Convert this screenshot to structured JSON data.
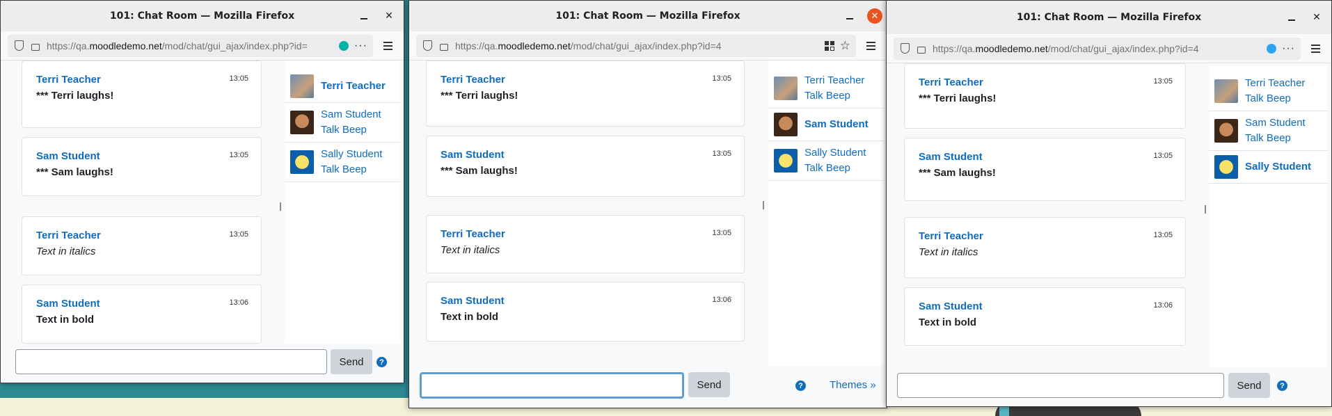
{
  "windows": [
    {
      "title": "101: Chat Room — Mozilla Firefox",
      "url_prefix": "https://qa.",
      "url_domain": "moodledemo.net",
      "url_path": "/mod/chat/gui_ajax/index.php?id=",
      "dot_color": "#00b3a4",
      "messages": [
        {
          "name": "Terri Teacher",
          "time": "13:05",
          "text": "*** Terri laughs!"
        },
        {
          "name": "Sam Student",
          "time": "13:05",
          "text": "*** Sam laughs!"
        },
        {
          "name": "Terri Teacher",
          "time": "13:05",
          "text": "Text in italics"
        },
        {
          "name": "Sam Student",
          "time": "13:06",
          "text": "Text in bold"
        }
      ],
      "users": [
        {
          "name": "Terri Teacher",
          "links": ""
        },
        {
          "name": "Sam Student",
          "links": "Talk Beep"
        },
        {
          "name": "Sally Student",
          "links": "Talk Beep"
        }
      ],
      "send_label": "Send",
      "help_label": "?"
    },
    {
      "title": "101: Chat Room — Mozilla Firefox",
      "url_prefix": "https://qa.",
      "url_domain": "moodledemo.net",
      "url_path": "/mod/chat/gui_ajax/index.php?id=4",
      "messages": [
        {
          "name": "Terri Teacher",
          "time": "13:05",
          "text": "*** Terri laughs!"
        },
        {
          "name": "Sam Student",
          "time": "13:05",
          "text": "*** Sam laughs!"
        },
        {
          "name": "Terri Teacher",
          "time": "13:05",
          "text": "Text in italics"
        },
        {
          "name": "Sam Student",
          "time": "13:06",
          "text": "Text in bold"
        }
      ],
      "users": [
        {
          "name": "Terri Teacher",
          "links": "Talk Beep"
        },
        {
          "name": "Sam Student",
          "links": ""
        },
        {
          "name": "Sally Student",
          "links": "Talk Beep"
        }
      ],
      "send_label": "Send",
      "help_label": "?",
      "themes_label": "Themes »"
    },
    {
      "title": "101: Chat Room — Mozilla Firefox",
      "url_prefix": "https://qa.",
      "url_domain": "moodledemo.net",
      "url_path": "/mod/chat/gui_ajax/index.php?id=4",
      "dot_color": "#2ea3f2",
      "messages": [
        {
          "name": "Terri Teacher",
          "time": "13:05",
          "text": "*** Terri laughs!"
        },
        {
          "name": "Sam Student",
          "time": "13:05",
          "text": "*** Sam laughs!"
        },
        {
          "name": "Terri Teacher",
          "time": "13:05",
          "text": "Text in italics"
        },
        {
          "name": "Sam Student",
          "time": "13:06",
          "text": "Text in bold"
        }
      ],
      "users": [
        {
          "name": "Terri Teacher",
          "links": "Talk Beep"
        },
        {
          "name": "Sam Student",
          "links": "Talk Beep"
        },
        {
          "name": "Sally Student",
          "links": ""
        }
      ],
      "send_label": "Send",
      "help_label": "?"
    }
  ],
  "colors": {
    "link": "#0f6cbf",
    "desktop": "#2c8a93",
    "close_active": "#e95420"
  }
}
